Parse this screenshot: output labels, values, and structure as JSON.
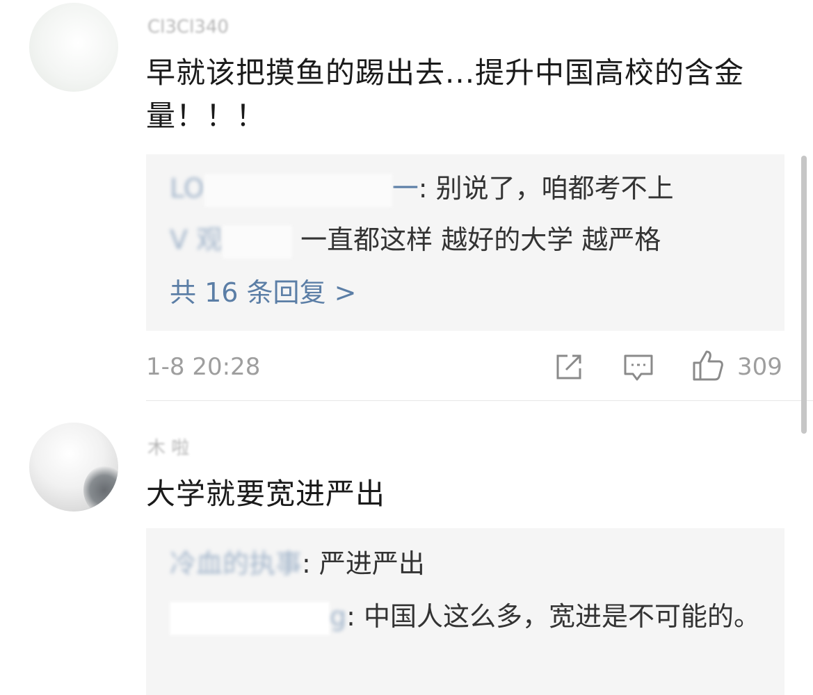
{
  "comments": [
    {
      "username": "Cl3Cl340",
      "text": "早就该把摸鱼的踢出去...提升中国高校的含金量！！！",
      "replies": [
        {
          "author": "LO",
          "tail": "一",
          "text": ": 别说了，咱都考不上"
        },
        {
          "author": "V 观",
          "text": "一直都这样 越好的大学 越严格"
        }
      ],
      "more_replies": "共 16 条回复 >",
      "time": "1-8 20:28",
      "likes": "309"
    },
    {
      "username": "木 啦",
      "text": "大学就要宽进严出",
      "replies": [
        {
          "author": "冷血的执事",
          "text": ": 严进严出"
        },
        {
          "author": "g",
          "text": ": 中国人这么多，宽进是不可能的。"
        }
      ]
    }
  ],
  "icons": {
    "share": "share-icon",
    "comment": "comment-icon",
    "like": "thumbs-up-icon"
  },
  "colors": {
    "link_blue": "#5b7ea6",
    "meta_gray": "#9e9e9e",
    "reply_bg": "#f5f5f5"
  }
}
